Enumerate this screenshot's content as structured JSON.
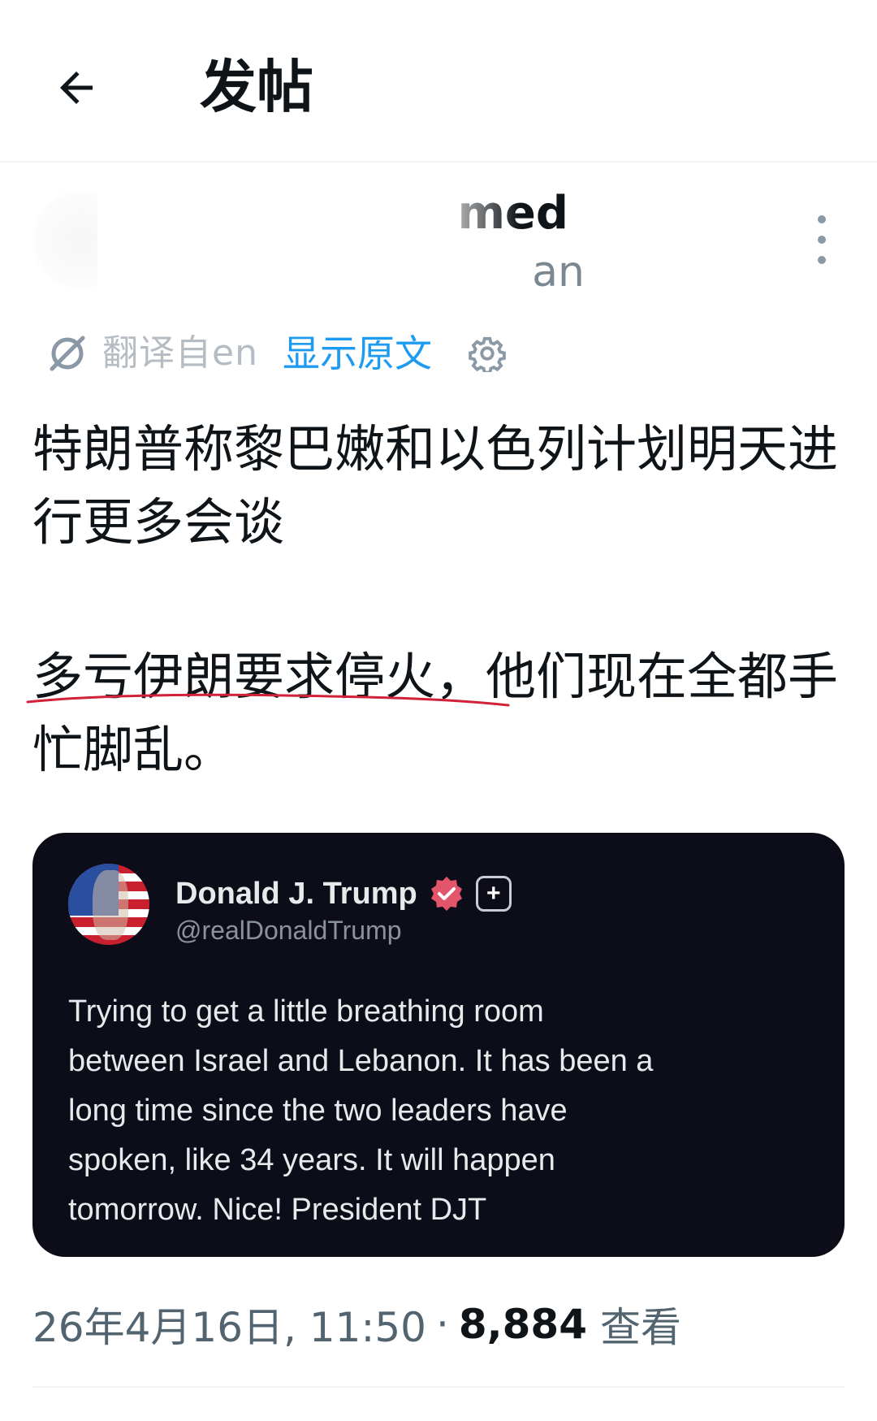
{
  "header": {
    "title": "发帖",
    "back_icon": "arrow-left-icon"
  },
  "author": {
    "name_partial": "med",
    "handle_partial": "an",
    "more_icon": "more-vertical-icon"
  },
  "translation": {
    "translated_from": "翻译自en",
    "show_original": "显示原文",
    "translate_icon": "translate-icon",
    "settings_icon": "gear-icon"
  },
  "post": {
    "paragraph1": "特朗普称黎巴嫩和以色列计划明天进行更多会谈",
    "paragraph2": "多亏伊朗要求停火，他们现在全都手忙脚乱。"
  },
  "embed": {
    "name": "Donald J. Trump",
    "handle": "@realDonaldTrump",
    "plus_badge": "+",
    "lines": [
      "Trying to get a little breathing room",
      "between Israel and Lebanon. It has been a",
      "long time since the two leaders have",
      "spoken, like 34 years. It will happen",
      "tomorrow. Nice! President DJT"
    ],
    "verified_color": "#e2556b",
    "background": "#0d0d1a"
  },
  "meta": {
    "date": "26年4月16日, 11:50",
    "separator": "·",
    "views_count": "8,884",
    "views_label": "查看"
  },
  "colors": {
    "text_primary": "#0f1419",
    "text_secondary": "#536471",
    "link": "#1d9bf0",
    "underline_annotation": "#d1223a"
  }
}
